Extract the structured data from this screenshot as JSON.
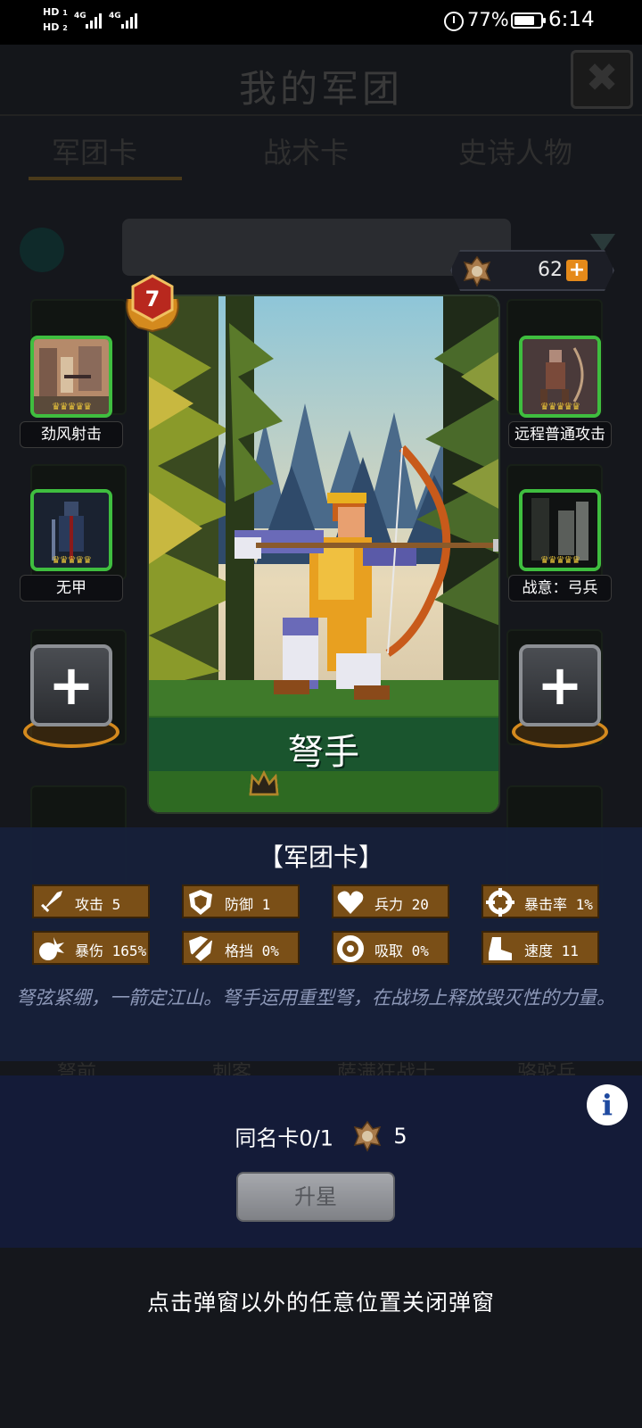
{
  "status_bar": {
    "hd1": "HD",
    "hd1_sub": "1",
    "hd2": "HD",
    "hd2_sub": "2",
    "network1": "4G",
    "network2": "4G",
    "battery_text": "77%",
    "battery_level": 0.77,
    "time": "6:14"
  },
  "background": {
    "title": "我的军团",
    "close_label": "✖",
    "tabs": [
      "军团卡",
      "战术卡",
      "史诗人物"
    ],
    "card_labels": [
      "弩前",
      "刺客",
      "萨满狂战士",
      "骆驼兵"
    ]
  },
  "currency": {
    "value": "62",
    "plus_label": "+"
  },
  "skills": {
    "left_top": "劲风射击",
    "left_mid": "无甲",
    "right_top": "远程普通攻击",
    "right_mid": "战意：弓兵",
    "crowns": "♛♛♛♛♛",
    "add_label": "+"
  },
  "card": {
    "name": "弩手",
    "level_badge": "7",
    "stars_filled": 0,
    "stars_total": 5
  },
  "panel": {
    "title": "【军团卡】",
    "stats": [
      {
        "icon": "sword-icon",
        "text": "攻击 5"
      },
      {
        "icon": "shield-icon",
        "text": "防御 1"
      },
      {
        "icon": "heart-icon",
        "text": "兵力 20"
      },
      {
        "icon": "crosshair-icon",
        "text": "暴击率 1%"
      },
      {
        "icon": "burst-icon",
        "text": "暴伤 165%"
      },
      {
        "icon": "block-icon",
        "text": "格挡 0%"
      },
      {
        "icon": "vortex-icon",
        "text": "吸取 0%"
      },
      {
        "icon": "boot-icon",
        "text": "速度 11"
      }
    ],
    "description": "弩弦紧绷，一箭定江山。弩手运用重型弩，在战场上释放毁灭性的力量。"
  },
  "bottom": {
    "info_label": "i",
    "copies_text": "同名卡0/1",
    "copies_cost": "5",
    "upgrade_label": "升星"
  },
  "close_hint": "点击弹窗以外的任意位置关闭弹窗",
  "colors": {
    "accent_orange": "#e58a1a",
    "stat_bg": "#7a4f17",
    "skill_border": "#3fbe3f",
    "panel_bg": "#16203a"
  }
}
